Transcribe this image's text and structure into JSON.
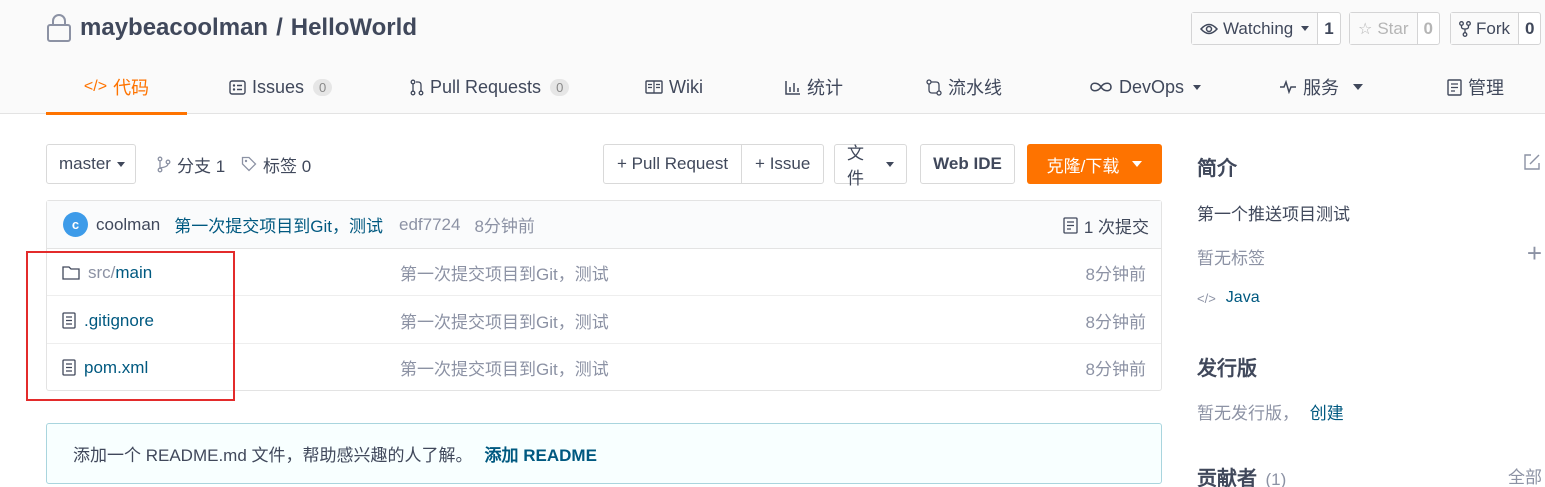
{
  "repo": {
    "owner": "maybeacoolman",
    "separator": "/",
    "name": "HelloWorld"
  },
  "actions": {
    "watch": {
      "label": "Watching",
      "count": "1"
    },
    "star": {
      "label": "Star",
      "count": "0"
    },
    "fork": {
      "label": "Fork",
      "count": "0"
    }
  },
  "tabs": [
    {
      "label": "代码",
      "icon": "code-icon",
      "active": true
    },
    {
      "label": "Issues",
      "badge": "0",
      "icon": "issues-icon"
    },
    {
      "label": "Pull Requests",
      "badge": "0",
      "icon": "pull-request-icon"
    },
    {
      "label": "Wiki",
      "icon": "wiki-icon"
    },
    {
      "label": "统计",
      "icon": "stats-icon"
    },
    {
      "label": "流水线",
      "icon": "pipeline-icon"
    },
    {
      "label": "DevOps",
      "icon": "devops-icon"
    },
    {
      "label": "服务",
      "icon": "service-icon"
    },
    {
      "label": "管理",
      "icon": "manage-icon"
    }
  ],
  "toolbar": {
    "branch": "master",
    "branches_label": "分支 1",
    "tags_label": "标签 0",
    "pull_request": "+ Pull Request",
    "issue": "+ Issue",
    "file_menu": "文件",
    "web_ide": "Web IDE",
    "clone": "克隆/下载"
  },
  "latest_commit": {
    "avatar_letter": "c",
    "author": "coolman",
    "message": "第一次提交项目到Git，测试",
    "hash": "edf7724",
    "time": "8分钟前",
    "commit_count": "1 次提交"
  },
  "files": [
    {
      "type": "folder",
      "prefix": "src/",
      "name": "main",
      "message": "第一次提交项目到Git，测试",
      "time": "8分钟前"
    },
    {
      "type": "file",
      "prefix": "",
      "name": ".gitignore",
      "message": "第一次提交项目到Git，测试",
      "time": "8分钟前"
    },
    {
      "type": "file",
      "prefix": "",
      "name": "pom.xml",
      "message": "第一次提交项目到Git，测试",
      "time": "8分钟前"
    }
  ],
  "readme_hint": {
    "text": "添加一个 README.md 文件，帮助感兴趣的人了解。",
    "link": "添加 README"
  },
  "sidebar": {
    "intro_title": "简介",
    "description": "第一个推送项目测试",
    "no_tags": "暂无标签",
    "language": "Java",
    "releases_title": "发行版",
    "no_releases": "暂无发行版，",
    "create": "创建",
    "contributors_title": "贡献者",
    "contributors_count": "(1)",
    "all": "全部"
  },
  "colors": {
    "accent": "#fe7300",
    "link": "#005980",
    "highlight": "#e32b2b"
  }
}
